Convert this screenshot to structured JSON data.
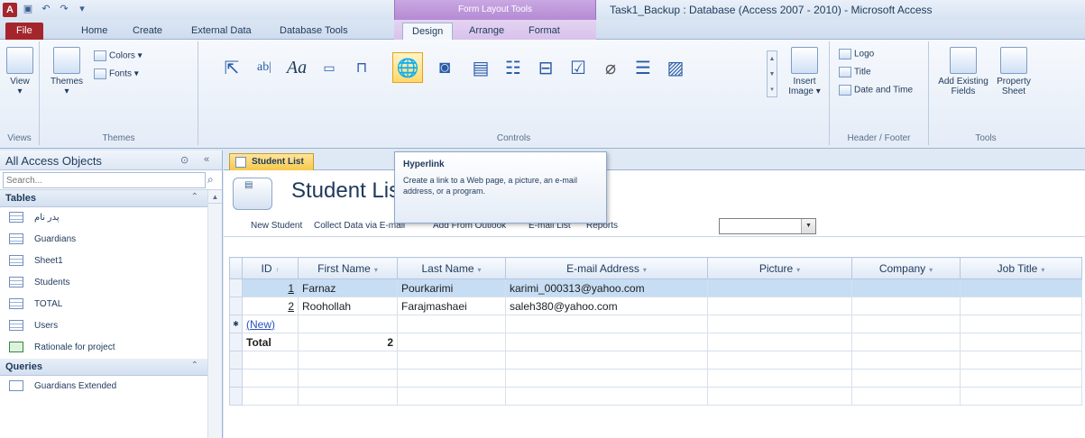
{
  "app": {
    "icon_letter": "A",
    "window_title": "Task1_Backup : Database (Access 2007 - 2010)  -  Microsoft Access",
    "contextual_group": "Form Layout Tools"
  },
  "ribbon_tabs": [
    "File",
    "Home",
    "Create",
    "External Data",
    "Database Tools",
    "Design",
    "Arrange",
    "Format"
  ],
  "ribbon": {
    "views": {
      "view_label": "View",
      "group": "Views"
    },
    "themes": {
      "themes_label": "Themes",
      "colors_label": "Colors",
      "fonts_label": "Fonts",
      "group": "Themes"
    },
    "controls": {
      "group": "Controls",
      "insert_image_label": "Insert Image"
    },
    "header_footer": {
      "logo": "Logo",
      "title": "Title",
      "date_time": "Date and Time",
      "group": "Header / Footer"
    },
    "tools": {
      "add_fields": "Add Existing Fields",
      "property_sheet": "Property Sheet",
      "group": "Tools"
    }
  },
  "tooltip": {
    "title": "Hyperlink",
    "body": "Create a link to a Web page, a picture, an e-mail address, or a program."
  },
  "nav": {
    "title": "All Access Objects",
    "search_placeholder": "Search...",
    "tables_header": "Tables",
    "tables": [
      "پدر نام",
      "Guardians",
      "Sheet1",
      "Students",
      "TOTAL",
      "Users",
      "Rationale for project"
    ],
    "queries_header": "Queries",
    "queries": [
      "Guardians Extended"
    ]
  },
  "document": {
    "tab_label": "Student List",
    "form_title": "Student List",
    "links": [
      "New Student",
      "Collect Data via E-mail",
      "Add From Outlook",
      "E-mail List",
      "Reports"
    ]
  },
  "datasheet": {
    "columns": [
      "ID",
      "First Name",
      "Last Name",
      "E-mail Address",
      "Picture",
      "Company",
      "Job Title"
    ],
    "rows": [
      {
        "id": "1",
        "first": "Farnaz",
        "last": "Pourkarimi",
        "email": "karimi_000313@yahoo.com"
      },
      {
        "id": "2",
        "first": "Roohollah",
        "last": "Farajmashaei",
        "email": "saleh380@yahoo.com"
      }
    ],
    "new_row_label": "(New)",
    "total_label": "Total",
    "total_value": "2"
  }
}
